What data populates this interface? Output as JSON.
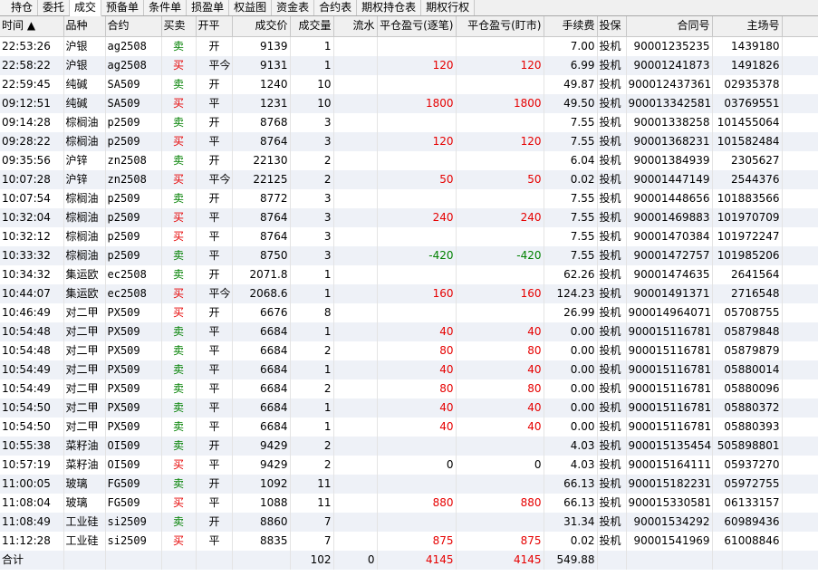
{
  "tabs": [
    "持仓",
    "委托",
    "成交",
    "预备单",
    "条件单",
    "损盈单",
    "权益图",
    "资金表",
    "合约表",
    "期权持仓表",
    "期权行权"
  ],
  "active_tab": 2,
  "headers": {
    "time": "时间 ▲",
    "product": "品种",
    "contract": "合约",
    "side": "买卖",
    "openclose": "开平",
    "price": "成交价",
    "qty": "成交量",
    "flow": "流水",
    "pnl_close": "平仓盈亏(逐笔)",
    "pnl_mtm": "平仓盈亏(盯市)",
    "fee": "手续费",
    "hedge": "投保",
    "contract_no": "合同号",
    "match_no": "主场号"
  },
  "rows": [
    {
      "time": "22:53:26",
      "product": "沪银",
      "contract": "ag2508",
      "side": "卖",
      "oc": "开",
      "price": "9139",
      "qty": "1",
      "flow": "",
      "pnl1": "",
      "pnl2": "",
      "fee": "7.00",
      "hedge": "投机",
      "cno": "90001235235",
      "mno": "1439180"
    },
    {
      "time": "22:58:22",
      "product": "沪银",
      "contract": "ag2508",
      "side": "买",
      "oc": "平今",
      "price": "9131",
      "qty": "1",
      "flow": "",
      "pnl1": "120",
      "pnl2": "120",
      "fee": "6.99",
      "hedge": "投机",
      "cno": "90001241873",
      "mno": "1491826"
    },
    {
      "time": "22:59:45",
      "product": "纯碱",
      "contract": "SA509",
      "side": "卖",
      "oc": "开",
      "price": "1240",
      "qty": "10",
      "flow": "",
      "pnl1": "",
      "pnl2": "",
      "fee": "49.87",
      "hedge": "投机",
      "cno": "9000124373615",
      "mno": "02935378"
    },
    {
      "time": "09:12:51",
      "product": "纯碱",
      "contract": "SA509",
      "side": "买",
      "oc": "平",
      "price": "1231",
      "qty": "10",
      "flow": "",
      "pnl1": "1800",
      "pnl2": "1800",
      "fee": "49.50",
      "hedge": "投机",
      "cno": "9000133425815",
      "mno": "03769551"
    },
    {
      "time": "09:14:28",
      "product": "棕榈油",
      "contract": "p2509",
      "side": "卖",
      "oc": "开",
      "price": "8768",
      "qty": "3",
      "flow": "",
      "pnl1": "",
      "pnl2": "",
      "fee": "7.55",
      "hedge": "投机",
      "cno": "90001338258",
      "mno": "101455064"
    },
    {
      "time": "09:28:22",
      "product": "棕榈油",
      "contract": "p2509",
      "side": "买",
      "oc": "平",
      "price": "8764",
      "qty": "3",
      "flow": "",
      "pnl1": "120",
      "pnl2": "120",
      "fee": "7.55",
      "hedge": "投机",
      "cno": "90001368231",
      "mno": "101582484"
    },
    {
      "time": "09:35:56",
      "product": "沪锌",
      "contract": "zn2508",
      "side": "卖",
      "oc": "开",
      "price": "22130",
      "qty": "2",
      "flow": "",
      "pnl1": "",
      "pnl2": "",
      "fee": "6.04",
      "hedge": "投机",
      "cno": "90001384939",
      "mno": "2305627"
    },
    {
      "time": "10:07:28",
      "product": "沪锌",
      "contract": "zn2508",
      "side": "买",
      "oc": "平今",
      "price": "22125",
      "qty": "2",
      "flow": "",
      "pnl1": "50",
      "pnl2": "50",
      "fee": "0.02",
      "hedge": "投机",
      "cno": "90001447149",
      "mno": "2544376"
    },
    {
      "time": "10:07:54",
      "product": "棕榈油",
      "contract": "p2509",
      "side": "卖",
      "oc": "开",
      "price": "8772",
      "qty": "3",
      "flow": "",
      "pnl1": "",
      "pnl2": "",
      "fee": "7.55",
      "hedge": "投机",
      "cno": "90001448656",
      "mno": "101883566"
    },
    {
      "time": "10:32:04",
      "product": "棕榈油",
      "contract": "p2509",
      "side": "买",
      "oc": "平",
      "price": "8764",
      "qty": "3",
      "flow": "",
      "pnl1": "240",
      "pnl2": "240",
      "fee": "7.55",
      "hedge": "投机",
      "cno": "90001469883",
      "mno": "101970709"
    },
    {
      "time": "10:32:12",
      "product": "棕榈油",
      "contract": "p2509",
      "side": "买",
      "oc": "平",
      "price": "8764",
      "qty": "3",
      "flow": "",
      "pnl1": "",
      "pnl2": "",
      "fee": "7.55",
      "hedge": "投机",
      "cno": "90001470384",
      "mno": "101972247"
    },
    {
      "time": "10:33:32",
      "product": "棕榈油",
      "contract": "p2509",
      "side": "卖",
      "oc": "平",
      "price": "8750",
      "qty": "3",
      "flow": "",
      "pnl1": "-420",
      "pnl2": "-420",
      "fee": "7.55",
      "hedge": "投机",
      "cno": "90001472757",
      "mno": "101985206"
    },
    {
      "time": "10:34:32",
      "product": "集运欧",
      "contract": "ec2508",
      "side": "卖",
      "oc": "开",
      "price": "2071.8",
      "qty": "1",
      "flow": "",
      "pnl1": "",
      "pnl2": "",
      "fee": "62.26",
      "hedge": "投机",
      "cno": "90001474635",
      "mno": "2641564"
    },
    {
      "time": "10:44:07",
      "product": "集运欧",
      "contract": "ec2508",
      "side": "买",
      "oc": "平今",
      "price": "2068.6",
      "qty": "1",
      "flow": "",
      "pnl1": "160",
      "pnl2": "160",
      "fee": "124.23",
      "hedge": "投机",
      "cno": "90001491371",
      "mno": "2716548"
    },
    {
      "time": "10:46:49",
      "product": "对二甲",
      "contract": "PX509",
      "side": "买",
      "oc": "开",
      "price": "6676",
      "qty": "8",
      "flow": "",
      "pnl1": "",
      "pnl2": "",
      "fee": "26.99",
      "hedge": "投机",
      "cno": "9000149640715",
      "mno": "05708755"
    },
    {
      "time": "10:54:48",
      "product": "对二甲",
      "contract": "PX509",
      "side": "卖",
      "oc": "平",
      "price": "6684",
      "qty": "1",
      "flow": "",
      "pnl1": "40",
      "pnl2": "40",
      "fee": "0.00",
      "hedge": "投机",
      "cno": "9000151167815",
      "mno": "05879848"
    },
    {
      "time": "10:54:48",
      "product": "对二甲",
      "contract": "PX509",
      "side": "卖",
      "oc": "平",
      "price": "6684",
      "qty": "2",
      "flow": "",
      "pnl1": "80",
      "pnl2": "80",
      "fee": "0.00",
      "hedge": "投机",
      "cno": "9000151167815",
      "mno": "05879879"
    },
    {
      "time": "10:54:49",
      "product": "对二甲",
      "contract": "PX509",
      "side": "卖",
      "oc": "平",
      "price": "6684",
      "qty": "1",
      "flow": "",
      "pnl1": "40",
      "pnl2": "40",
      "fee": "0.00",
      "hedge": "投机",
      "cno": "9000151167815",
      "mno": "05880014"
    },
    {
      "time": "10:54:49",
      "product": "对二甲",
      "contract": "PX509",
      "side": "卖",
      "oc": "平",
      "price": "6684",
      "qty": "2",
      "flow": "",
      "pnl1": "80",
      "pnl2": "80",
      "fee": "0.00",
      "hedge": "投机",
      "cno": "9000151167815",
      "mno": "05880096"
    },
    {
      "time": "10:54:50",
      "product": "对二甲",
      "contract": "PX509",
      "side": "卖",
      "oc": "平",
      "price": "6684",
      "qty": "1",
      "flow": "",
      "pnl1": "40",
      "pnl2": "40",
      "fee": "0.00",
      "hedge": "投机",
      "cno": "9000151167815",
      "mno": "05880372"
    },
    {
      "time": "10:54:50",
      "product": "对二甲",
      "contract": "PX509",
      "side": "卖",
      "oc": "平",
      "price": "6684",
      "qty": "1",
      "flow": "",
      "pnl1": "40",
      "pnl2": "40",
      "fee": "0.00",
      "hedge": "投机",
      "cno": "9000151167815",
      "mno": "05880393"
    },
    {
      "time": "10:55:38",
      "product": "菜籽油",
      "contract": "OI509",
      "side": "卖",
      "oc": "开",
      "price": "9429",
      "qty": "2",
      "flow": "",
      "pnl1": "",
      "pnl2": "",
      "fee": "4.03",
      "hedge": "投机",
      "cno": "9000151354541",
      "mno": "505898801"
    },
    {
      "time": "10:57:19",
      "product": "菜籽油",
      "contract": "OI509",
      "side": "买",
      "oc": "平",
      "price": "9429",
      "qty": "2",
      "flow": "",
      "pnl1": "0",
      "pnl2": "0",
      "fee": "4.03",
      "hedge": "投机",
      "cno": "9000151641115",
      "mno": "05937270"
    },
    {
      "time": "11:00:05",
      "product": "玻璃",
      "contract": "FG509",
      "side": "卖",
      "oc": "开",
      "price": "1092",
      "qty": "11",
      "flow": "",
      "pnl1": "",
      "pnl2": "",
      "fee": "66.13",
      "hedge": "投机",
      "cno": "9000151822315",
      "mno": "05972755"
    },
    {
      "time": "11:08:04",
      "product": "玻璃",
      "contract": "FG509",
      "side": "买",
      "oc": "平",
      "price": "1088",
      "qty": "11",
      "flow": "",
      "pnl1": "880",
      "pnl2": "880",
      "fee": "66.13",
      "hedge": "投机",
      "cno": "9000153305815",
      "mno": "06133157"
    },
    {
      "time": "11:08:49",
      "product": "工业硅",
      "contract": "si2509",
      "side": "卖",
      "oc": "开",
      "price": "8860",
      "qty": "7",
      "flow": "",
      "pnl1": "",
      "pnl2": "",
      "fee": "31.34",
      "hedge": "投机",
      "cno": "90001534292",
      "mno": "60989436"
    },
    {
      "time": "11:12:28",
      "product": "工业硅",
      "contract": "si2509",
      "side": "买",
      "oc": "平",
      "price": "8835",
      "qty": "7",
      "flow": "",
      "pnl1": "875",
      "pnl2": "875",
      "fee": "0.02",
      "hedge": "投机",
      "cno": "90001541969",
      "mno": "61008846"
    }
  ],
  "footer": {
    "label": "合计",
    "qty": "102",
    "flow": "0",
    "pnl1": "4145",
    "pnl2": "4145",
    "fee": "549.88"
  },
  "colors": {
    "buy": "#e60000",
    "sell": "#008000",
    "profit": "#e60000",
    "loss": "#008000"
  }
}
